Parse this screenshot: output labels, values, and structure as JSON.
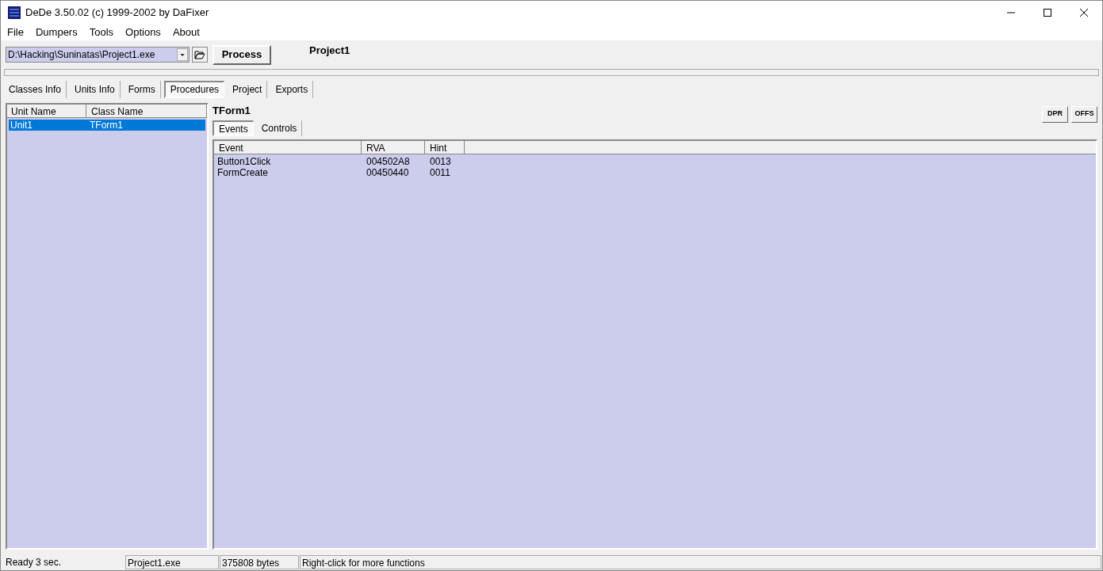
{
  "window": {
    "title": "DeDe 3.50.02 (c) 1999-2002 by DaFixer"
  },
  "menu": [
    "File",
    "Dumpers",
    "Tools",
    "Options",
    "About"
  ],
  "toolbar": {
    "file_path": "D:\\Hacking\\Suninatas\\Project1.exe",
    "process_button": "Process",
    "project_name": "Project1"
  },
  "progress": {
    "level": 0
  },
  "tabs": [
    {
      "label": "Classes Info",
      "selected": false
    },
    {
      "label": "Units Info",
      "selected": false
    },
    {
      "label": "Forms",
      "selected": false
    },
    {
      "label": "Procedures",
      "selected": true
    },
    {
      "label": "Project",
      "selected": false
    },
    {
      "label": "Exports",
      "selected": false
    }
  ],
  "units": {
    "columns": [
      "Unit Name",
      "Class Name"
    ],
    "rows": [
      {
        "unit": "Unit1",
        "class": "TForm1",
        "selected": true
      }
    ]
  },
  "form_title": "TForm1",
  "side_buttons": [
    "DPR",
    "OFFS"
  ],
  "subtabs": [
    {
      "label": "Events",
      "selected": true
    },
    {
      "label": "Controls",
      "selected": false
    }
  ],
  "events": {
    "columns": [
      "Event",
      "RVA",
      "Hint"
    ],
    "rows": [
      [
        "Button1Click",
        "004502A8",
        "0013"
      ],
      [
        "FormCreate",
        "00450440",
        "0011"
      ]
    ]
  },
  "status_bar": [
    "Ready 3 sec.",
    "Project1.exe",
    "375808 bytes",
    "Right-click for more functions"
  ]
}
